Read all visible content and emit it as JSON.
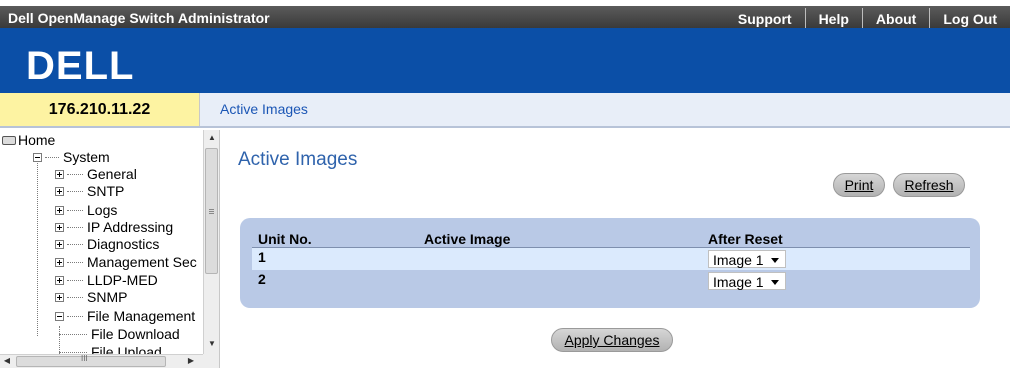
{
  "header": {
    "app_title": "Dell OpenManage Switch Administrator",
    "links": [
      "Support",
      "Help",
      "About",
      "Log Out"
    ],
    "logo_text": "DELL",
    "brand_color": "#0b4fa7"
  },
  "device": {
    "ip": "176.210.11.22"
  },
  "breadcrumb": "Active Images",
  "nav": {
    "home": "Home",
    "system": "System",
    "items": [
      "General",
      "SNTP",
      "Logs",
      "IP Addressing",
      "Diagnostics",
      "Management Sec",
      "LLDP-MED",
      "SNMP"
    ],
    "file_management": "File Management",
    "file_children": [
      "File Download",
      "File Upload"
    ],
    "hscroll_grip": "III"
  },
  "main": {
    "title": "Active Images",
    "print_label": "Print",
    "refresh_label": "Refresh",
    "table": {
      "columns": [
        "Unit No.",
        "Active Image",
        "After Reset"
      ],
      "rows": [
        {
          "unit": "1",
          "active_image": "",
          "after_reset": "Image 1"
        },
        {
          "unit": "2",
          "active_image": "",
          "after_reset": "Image 1"
        }
      ]
    },
    "apply_label": "Apply Changes"
  }
}
